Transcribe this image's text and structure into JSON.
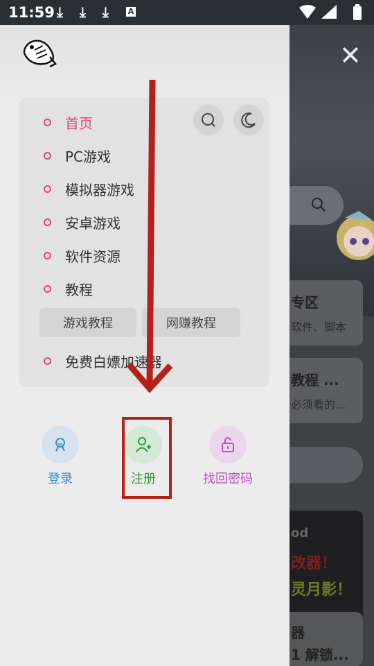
{
  "status_bar": {
    "time": "11:59",
    "download_icons": 3
  },
  "drawer": {
    "menu": [
      {
        "label": "首页",
        "active": true
      },
      {
        "label": "PC游戏"
      },
      {
        "label": "模拟器游戏"
      },
      {
        "label": "安卓游戏"
      },
      {
        "label": "软件资源"
      },
      {
        "label": "教程"
      },
      {
        "label": "免费白嫖加速器"
      }
    ],
    "sub_buttons": [
      "游戏教程",
      "网赚教程"
    ],
    "actions": [
      {
        "label": "登录",
        "color": "#2f8fd0"
      },
      {
        "label": "注册",
        "color": "#2f9a3a"
      },
      {
        "label": "找回密码",
        "color": "#c24cc6"
      }
    ]
  },
  "background": {
    "card1_title": "专区",
    "card1_sub": "软件、脚本",
    "card2_title": "教程 ...",
    "card2_sub": "必须看的...",
    "card3_a": "od",
    "card3_b": "改器！",
    "card3_c": "灵月影！",
    "card3_d": "器",
    "card3_e": "1 解锁..."
  },
  "colors": {
    "accent": "#e0457b",
    "annotation": "#b6201a"
  }
}
